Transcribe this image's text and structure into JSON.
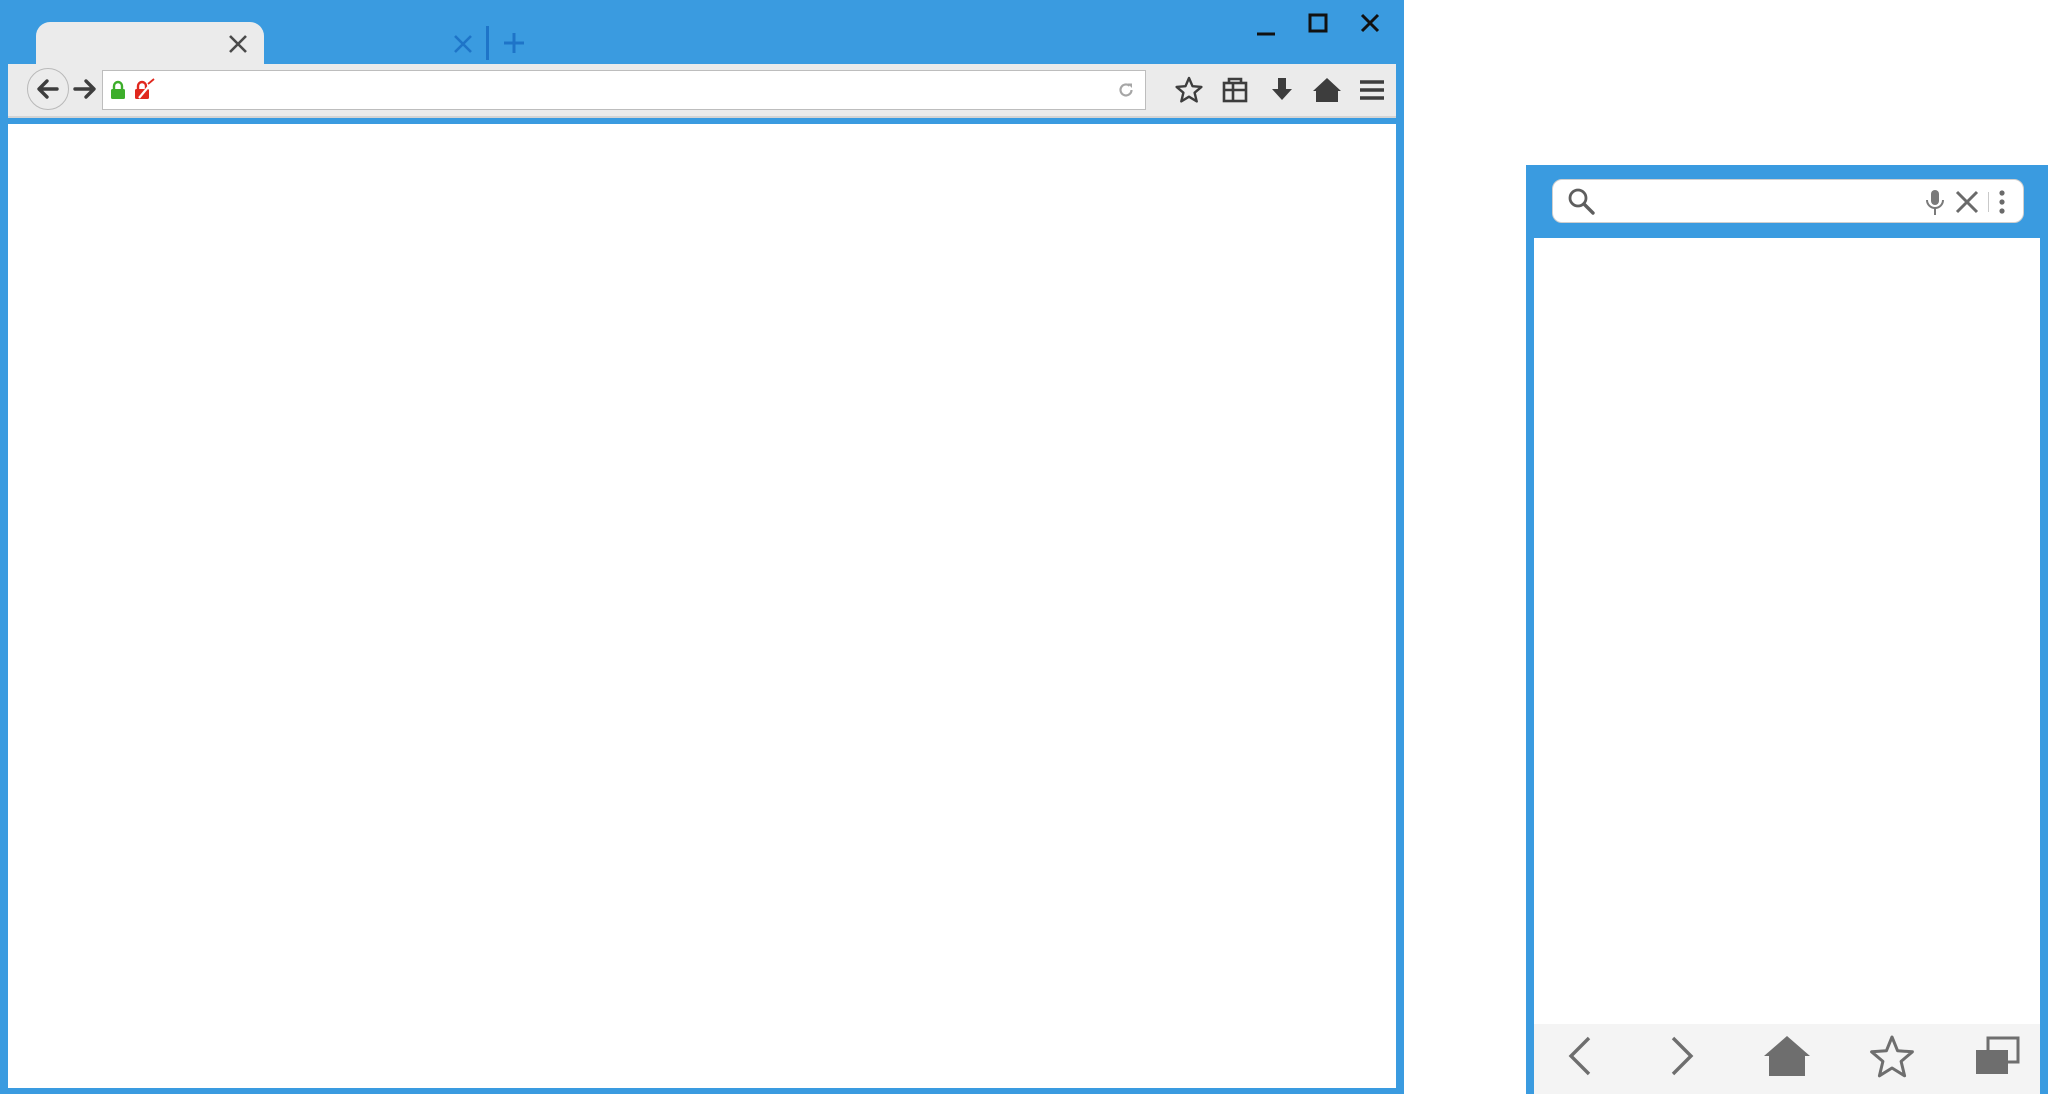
{
  "desktop": {
    "tabs": [
      {
        "title": "",
        "active": true
      },
      {
        "title": "",
        "active": false
      }
    ],
    "url": {
      "value": "",
      "placeholder": ""
    },
    "icons": {
      "back": "arrow-left-icon",
      "forward": "arrow-right-icon",
      "secure_lock": "lock-icon",
      "insecure_lock": "broken-lock-icon",
      "reload": "reload-icon",
      "bookmark": "star-icon",
      "library": "library-icon",
      "downloads": "download-arrow-icon",
      "home": "home-icon",
      "menu": "hamburger-icon",
      "new_tab": "plus-icon"
    }
  },
  "mobile": {
    "search": {
      "value": "",
      "placeholder": ""
    },
    "icons": {
      "search": "search-icon",
      "mic": "microphone-icon",
      "clear": "close-icon",
      "overflow": "kebab-icon",
      "back": "chevron-left-icon",
      "forward": "chevron-right-icon",
      "home": "home-icon",
      "bookmark": "star-outline-icon",
      "tabs": "tabs-icon"
    }
  },
  "colors": {
    "frame": "#3a9be0",
    "toolbar": "#ebebeb",
    "icon_dark": "#4a4a4a",
    "icon_gray": "#7a7a7a",
    "tab_accent": "#1e74c8",
    "secure_green": "#3dae2b",
    "insecure_red": "#e0281e"
  }
}
